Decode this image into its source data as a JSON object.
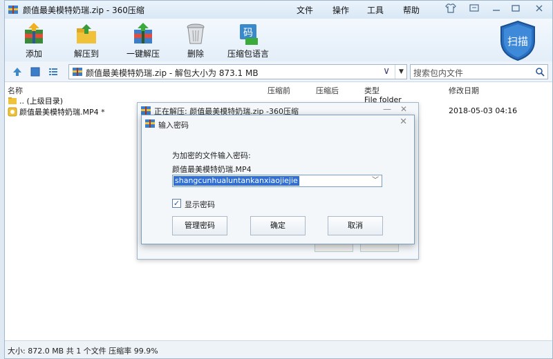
{
  "window": {
    "title": "颜值最美模特奶瑞.zip - 360压缩",
    "menu": [
      "文件",
      "操作",
      "工具",
      "帮助"
    ]
  },
  "toolbar": {
    "buttons": [
      {
        "label": "添加",
        "icon": "add-archive-icon"
      },
      {
        "label": "解压到",
        "icon": "extract-to-icon"
      },
      {
        "label": "一键解压",
        "icon": "one-click-extract-icon"
      },
      {
        "label": "删除",
        "icon": "delete-trash-icon"
      },
      {
        "label": "压缩包语言",
        "icon": "archive-language-icon"
      }
    ],
    "scan_label": "扫描"
  },
  "address": {
    "text": "颜值最美模特奶瑞.zip - 解包大小为 873.1 MB"
  },
  "search": {
    "placeholder": "搜索包内文件"
  },
  "columns": {
    "name": "名称",
    "compressed": "压缩前",
    "packed": "压缩后",
    "type": "类型",
    "modified": "修改日期"
  },
  "files": [
    {
      "name": ".. (上级目录)",
      "type": "File folder",
      "modified": ""
    },
    {
      "name": "颜值最美模特奶瑞.MP4 *",
      "type": "",
      "modified": "2018-05-03 04:16"
    }
  ],
  "status": {
    "text": "大小: 872.0 MB 共 1 个文件 压缩率 99.9%"
  },
  "progress_dialog": {
    "title": "正在解压: 颜值最美模特奶瑞.zip -360压缩"
  },
  "password_dialog": {
    "title": "输入密码",
    "prompt": "为加密的文件输入密码:",
    "filename": "颜值最美模特奶瑞.MP4",
    "password": "shangcunhualuntankanxiaojiejie",
    "show_password_label": "显示密码",
    "show_password_checked": true,
    "buttons": {
      "manage": "管理密码",
      "ok": "确定",
      "cancel": "取消"
    }
  },
  "colors": {
    "accent": "#2f6fd6",
    "titlebar": "#d9e8f6",
    "shield": "#2a6fc0"
  }
}
